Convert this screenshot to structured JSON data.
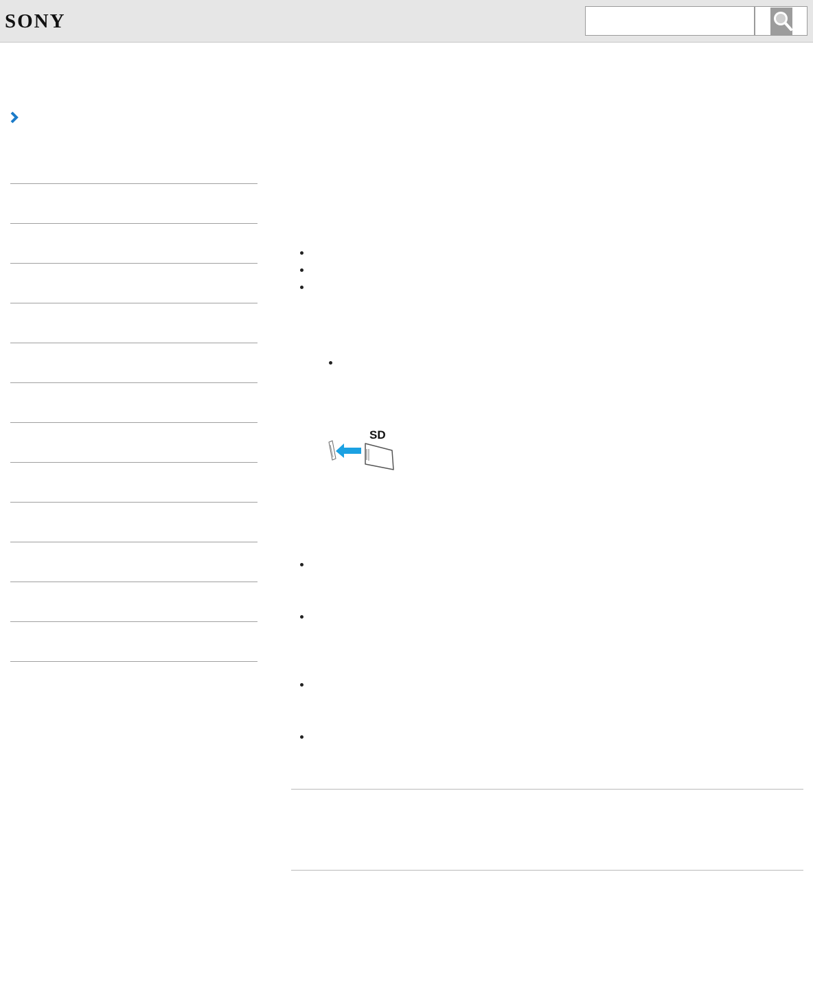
{
  "header": {
    "logo_text": "SONY",
    "search": {
      "placeholder": "",
      "value": ""
    }
  },
  "icons": {
    "search_button": "search-icon",
    "breadcrumb": "chevron-right-icon",
    "illustration": "sd-card-insert-illustration"
  },
  "illustration": {
    "card_label": "SD"
  },
  "sidebar": {
    "items": [
      {
        "label": ""
      },
      {
        "label": ""
      },
      {
        "label": ""
      },
      {
        "label": ""
      },
      {
        "label": ""
      },
      {
        "label": ""
      },
      {
        "label": ""
      },
      {
        "label": ""
      },
      {
        "label": ""
      },
      {
        "label": ""
      },
      {
        "label": ""
      },
      {
        "label": ""
      },
      {
        "label": ""
      }
    ]
  },
  "colors": {
    "header_bg": "#e6e6e6",
    "accent": "#1b7bc9",
    "arrow_blue": "#1ba1e2"
  }
}
